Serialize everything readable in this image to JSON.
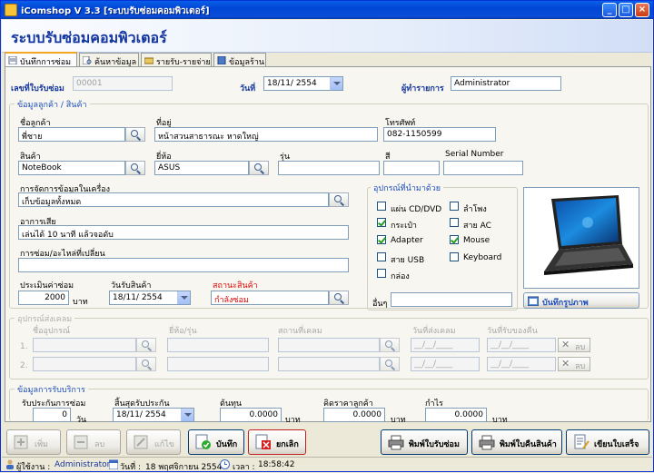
{
  "window": {
    "title": "iComshop V 3.3  [ระบบรับซ่อมคอมพิวเตอร์]"
  },
  "header": {
    "title": "ระบบรับซ่อมคอมพิวเตอร์"
  },
  "tabs": [
    {
      "label": "บันทึกการซ่อม"
    },
    {
      "label": "ค้นหาข้อมูล"
    },
    {
      "label": "รายรับ-รายจ่าย"
    },
    {
      "label": "ข้อมูลร้าน"
    }
  ],
  "top": {
    "job_no_label": "เลขที่ใบรับซ่อม",
    "job_no_value": "00001",
    "date_label": "วันที่",
    "date_value": "18/11/  2554",
    "operator_label": "ผู้ทำรายการ",
    "operator_value": "Administrator"
  },
  "customer": {
    "group_title": "ข้อมูลลูกค้า / สินค้า",
    "name_label": "ชื่อลูกค้า",
    "name_value": "พี่ชาย",
    "address_label": "ที่อยู่",
    "address_value": "หน้าสวนสาธารณะ หาดใหญ่",
    "phone_label": "โทรศัพท์",
    "phone_value": "082-1150599",
    "product_label": "สินค้า",
    "product_value": "NoteBook",
    "brand_label": "ยี่ห้อ",
    "brand_value": "ASUS",
    "model_label": "รุ่น",
    "model_value": "",
    "color_label": "สี",
    "color_value": "",
    "serial_label": "Serial Number",
    "serial_value": "",
    "data_mgmt_label": "การจัดการข้อมูลในเครื่อง",
    "data_mgmt_value": "เก็บข้อมูลทั้งหมด",
    "symptom_label": "อาการเสีย",
    "symptom_value": "เล่นได้ 10 นาที แล้วจอดับ",
    "parts_label": "การซ่อม/อะไหล่ที่เปลี่ยน",
    "parts_value": "",
    "estimate_label": "ประเมินค่าซ่อม",
    "estimate_value": "2000",
    "estimate_unit": "บาท",
    "receive_date_label": "วันรับสินค้า",
    "receive_date_value": "18/11/  2554",
    "status_label": "สถานะสินค้า",
    "status_value": "กำลังซ่อม"
  },
  "accessories": {
    "group_title": "อุปกรณ์ที่นำมาด้วย",
    "items": [
      {
        "label": "แผ่น CD/DVD",
        "checked": false
      },
      {
        "label": "ลำโพง",
        "checked": false
      },
      {
        "label": "กระเป๋า",
        "checked": true
      },
      {
        "label": "สาย AC",
        "checked": false
      },
      {
        "label": "Adapter",
        "checked": true
      },
      {
        "label": "Mouse",
        "checked": true
      },
      {
        "label": "สาย USB",
        "checked": false
      },
      {
        "label": "Keyboard",
        "checked": false
      },
      {
        "label": "กล่อง",
        "checked": false
      }
    ],
    "other_label": "อื่นๆ",
    "other_value": ""
  },
  "photo": {
    "save_label": "บันทึกรูปภาพ"
  },
  "send_claim": {
    "group_title": "อุปกรณ์ส่งเคลม",
    "col_device": "ชื่ออุปกรณ์",
    "col_brand": "ยี่ห้อ/รุ่น",
    "col_place": "สถานที่เคลม",
    "col_send_date": "วันที่ส่งเคลม",
    "col_return_date": "วันที่รับของคืน",
    "rows": [
      {
        "no": "1.",
        "send_date": "__/__/____",
        "return_date": "__/__/____",
        "delete_label": "ลบ"
      },
      {
        "no": "2.",
        "send_date": "__/__/____",
        "return_date": "__/__/____",
        "delete_label": "ลบ"
      }
    ]
  },
  "service": {
    "group_title": "ข้อมูลการรับบริการ",
    "duration_label": "รับประกันการซ่อม",
    "duration_value": "0",
    "duration_unit": "วัน",
    "warranty_end_label": "สิ้นสุดรับประกัน",
    "warranty_end_value": "18/11/  2554",
    "cost_label": "ต้นทุน",
    "cost_value": "0.0000",
    "cost_unit": "บาท",
    "charge_label": "คิดราคาลูกค้า",
    "charge_value": "0.0000",
    "charge_unit": "บาท",
    "profit_label": "กำไร",
    "profit_value": "0.0000",
    "profit_unit": "บาท"
  },
  "buttons": {
    "add": "เพิ่ม",
    "delete": "ลบ",
    "edit": "แก้ไข",
    "save": "บันทึก",
    "cancel": "ยกเลิก",
    "print_receipt": "พิมพ์ใบรับซ่อม",
    "print_return": "พิมพ์ใบคืนสินค้า",
    "write_receipt": "เขียนใบเสร็จ"
  },
  "status": {
    "user_label": "ผู้ใช้งาน :",
    "user_value": "Administrator",
    "date_label": "วันที่ :",
    "date_value": "18 พฤศจิกายน 2554",
    "time_label": "เวลา :",
    "time_value": "18:58:42"
  },
  "colors": {
    "title_blue": "#0A4DD8",
    "header_text": "#1336A0",
    "status_red": "#E00000",
    "group_blue": "#1E4EBA"
  }
}
